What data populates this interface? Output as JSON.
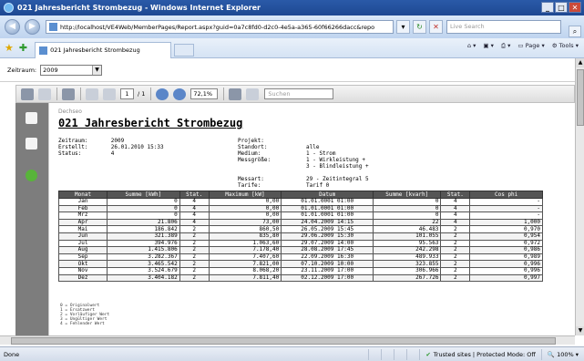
{
  "window": {
    "title": "021 Jahresbericht Strombezug - Windows Internet Explorer",
    "controls": [
      "_",
      "□",
      "✕"
    ]
  },
  "address": {
    "url": "http://localhost/VE4Web/MemberPages/Report.aspx?guid=0a7c8fd0-d2c0-4e5a-a365-60f66266dacc&repo",
    "search_placeholder": "Live Search"
  },
  "tab": {
    "label": "021 Jahresbericht Strombezug"
  },
  "commandbar": {
    "page": "Page",
    "tools": "Tools"
  },
  "filter": {
    "label": "Zeitraum:",
    "value": "2009"
  },
  "report_toolbar": {
    "page_current": "1",
    "page_total": "/ 1",
    "zoom": "72,1%",
    "find_placeholder": "Suchen"
  },
  "report": {
    "small_header": "Dechseo",
    "title": "021 Jahresbericht Strombezug",
    "left_block": "Zeitraum:       2009\nErstellt:       26.01.2010 15:33\nStatus:         4",
    "right_labels": "Projekt:\nStandort:\nMedium:\nMessgröße:\n\n\nMessart:\nTarife:",
    "right_values": "\nalle\n1 - Strom\n1 - Wirkleistung +\n3 - Blindleistung +\n\n29 - Zeitintegral 5\nTarif 0",
    "columns": [
      "Monat",
      "Summe [kWh]",
      "Stat.",
      "Maximum [kW]",
      "Datum",
      "Summe [kvarh]",
      "Stat.",
      "Cos phi"
    ],
    "rows": [
      [
        "Jan",
        "0",
        "4",
        "0,00",
        "01.01.0001 01:00",
        "0",
        "4",
        "-"
      ],
      [
        "Feb",
        "0",
        "4",
        "0,00",
        "01.01.0001 01:00",
        "0",
        "4",
        "-"
      ],
      [
        "Mrz",
        "0",
        "4",
        "0,00",
        "01.01.0001 01:00",
        "0",
        "4",
        "-"
      ],
      [
        "Apr",
        "21.806",
        "4",
        "73,00",
        "24.04.2009 14:15",
        "22",
        "4",
        "1,000"
      ],
      [
        "Mai",
        "186.842",
        "2",
        "860,50",
        "26.05.2009 15:45",
        "46.483",
        "2",
        "0,970"
      ],
      [
        "Jun",
        "321.389",
        "2",
        "835,80",
        "29.06.2009 15:30",
        "101.055",
        "2",
        "0,954"
      ],
      [
        "Jul",
        "394.976",
        "2",
        "1.063,60",
        "29.07.2009 14:00",
        "95.563",
        "2",
        "0,972"
      ],
      [
        "Aug",
        "1.415.806",
        "2",
        "7.178,40",
        "28.08.2009 17:45",
        "242.298",
        "2",
        "0,986"
      ],
      [
        "Sep",
        "3.282.367",
        "2",
        "7.407,60",
        "22.09.2009 16:30",
        "489.933",
        "2",
        "0,989"
      ],
      [
        "Okt",
        "3.465.542",
        "2",
        "7.821,00",
        "07.10.2009 10:00",
        "323.855",
        "2",
        "0,996"
      ],
      [
        "Nov",
        "3.524.679",
        "2",
        "8.068,20",
        "23.11.2009 17:00",
        "306.966",
        "2",
        "0,996"
      ],
      [
        "Dez",
        "3.404.182",
        "2",
        "7.811,40",
        "02.12.2009 17:00",
        "267.726",
        "2",
        "0,997"
      ]
    ],
    "legend": "0 = Originalwert\n1 = Ersatzwert\n2 = Vorläufiger Wert\n3 = Ungültiger Wert\n4 = Fehlender Wert"
  },
  "status": {
    "left": "Done",
    "zone": "Trusted sites | Protected Mode: Off",
    "zoom": "100%"
  }
}
